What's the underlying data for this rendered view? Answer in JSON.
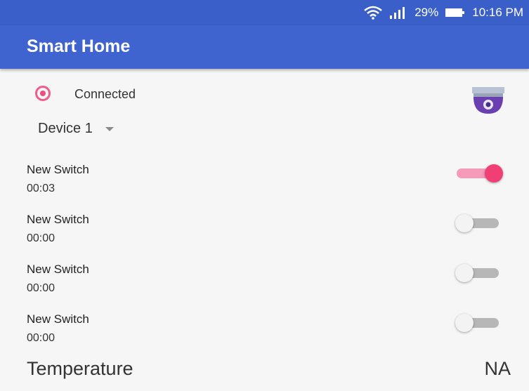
{
  "status_bar": {
    "battery_percent": "29%",
    "time": "10:16 PM"
  },
  "app_bar": {
    "title": "Smart Home"
  },
  "connection": {
    "status": "Connected"
  },
  "device": {
    "selected": "Device 1"
  },
  "switches": [
    {
      "name": "New Switch",
      "time": "00:03",
      "on": true
    },
    {
      "name": "New Switch",
      "time": "00:00",
      "on": false
    },
    {
      "name": "New Switch",
      "time": "00:00",
      "on": false
    },
    {
      "name": "New Switch",
      "time": "00:00",
      "on": false
    }
  ],
  "temperature": {
    "label": "Temperature",
    "value": "NA"
  },
  "icons": [
    "wifi-icon",
    "signal-icon",
    "battery-icon",
    "camera-icon",
    "chevron-down-icon"
  ],
  "colors": {
    "primary": "#3f63cf",
    "accent": "#ef3f74"
  }
}
